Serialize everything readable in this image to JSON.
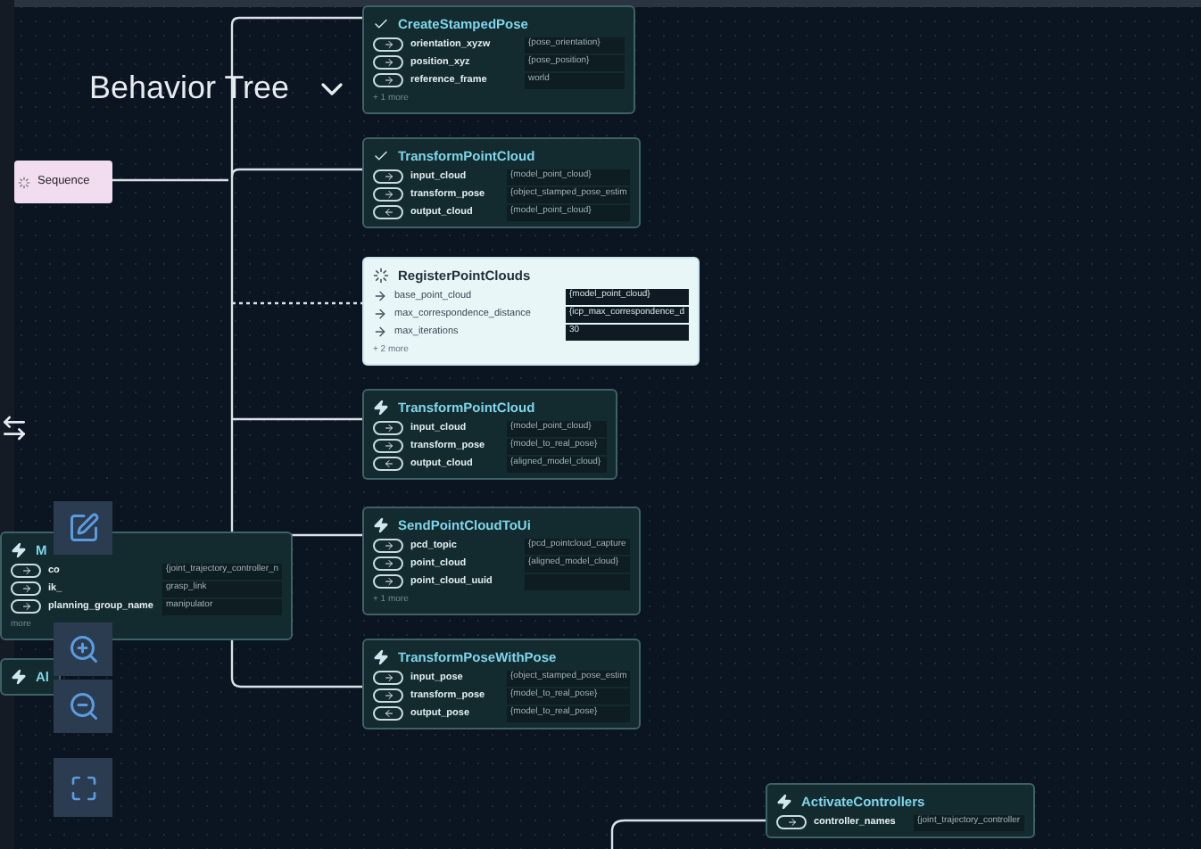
{
  "header": {
    "title": "Behavior Tree"
  },
  "sequence": {
    "label": "Sequence"
  },
  "nodes": [
    {
      "title": "CreateStampedPose",
      "kind": "done",
      "selected": false,
      "ports": [
        {
          "name": "orientation_xyzw",
          "value": "{pose_orientation}",
          "kind": "input"
        },
        {
          "name": "position_xyz",
          "value": "{pose_position}",
          "kind": "input"
        },
        {
          "name": "reference_frame",
          "value": "world",
          "kind": "input"
        }
      ],
      "more": "+ 1 more"
    },
    {
      "title": "TransformPointCloud",
      "kind": "done",
      "selected": false,
      "ports": [
        {
          "name": "input_cloud",
          "value": "{model_point_cloud}",
          "kind": "input"
        },
        {
          "name": "transform_pose",
          "value": "{object_stamped_pose_estim",
          "kind": "input"
        },
        {
          "name": "output_cloud",
          "value": "{model_point_cloud}",
          "kind": "output"
        }
      ]
    },
    {
      "title": "RegisterPointClouds",
      "kind": "running",
      "selected": true,
      "ports": [
        {
          "name": "base_point_cloud",
          "value": "{model_point_cloud}",
          "kind": "input"
        },
        {
          "name": "max_correspondence_distance",
          "value": "{icp_max_correspondence_d",
          "kind": "input"
        },
        {
          "name": "max_iterations",
          "value": "30",
          "kind": "input"
        }
      ],
      "more": "+ 2 more"
    },
    {
      "title": "TransformPointCloud",
      "kind": "pending",
      "selected": false,
      "ports": [
        {
          "name": "input_cloud",
          "value": "{model_point_cloud}",
          "kind": "input"
        },
        {
          "name": "transform_pose",
          "value": "{model_to_real_pose}",
          "kind": "input"
        },
        {
          "name": "output_cloud",
          "value": "{aligned_model_cloud}",
          "kind": "output"
        }
      ]
    },
    {
      "title": "SendPointCloudToUi",
      "kind": "pending",
      "selected": false,
      "ports": [
        {
          "name": "pcd_topic",
          "value": "{pcd_pointcloud_capture",
          "kind": "input"
        },
        {
          "name": "point_cloud",
          "value": "{aligned_model_cloud}",
          "kind": "input"
        },
        {
          "name": "point_cloud_uuid",
          "kind": "input"
        }
      ],
      "more": "+ 1 more"
    },
    {
      "title": "TransformPoseWithPose",
      "kind": "pending",
      "selected": false,
      "ports": [
        {
          "name": "input_pose",
          "value": "{object_stamped_pose_estim",
          "kind": "input"
        },
        {
          "name": "transform_pose",
          "value": "{model_to_real_pose}",
          "kind": "input"
        },
        {
          "name": "output_pose",
          "value": "{model_to_real_pose}",
          "kind": "output"
        }
      ]
    },
    {
      "title": "M",
      "kind": "pending",
      "selected": false,
      "ports": [
        {
          "name": "co",
          "value": "{joint_trajectory_controller_n",
          "kind": "input"
        },
        {
          "name": "ik_",
          "value": "grasp_link",
          "kind": "input"
        },
        {
          "name": "planning_group_name",
          "value": "manipulator",
          "kind": "input"
        }
      ],
      "more": "more"
    },
    {
      "title": "Al",
      "kind": "pending",
      "selected": false
    },
    {
      "title": "ActivateControllers",
      "kind": "pending",
      "selected": false,
      "ports": [
        {
          "name": "controller_names",
          "value": "{joint_trajectory_controller",
          "kind": "input"
        }
      ]
    }
  ]
}
